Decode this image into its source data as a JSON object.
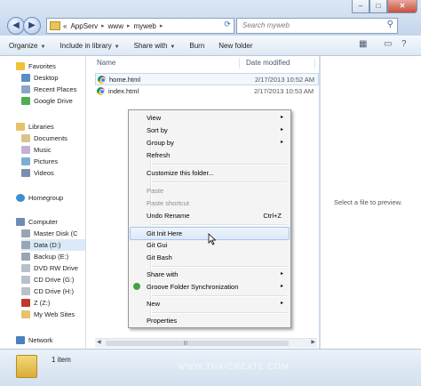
{
  "window": {
    "controls": {
      "minimize": "–",
      "maximize": "□",
      "close": "✕"
    }
  },
  "address_bar": {
    "breadcrumbs": [
      "AppServ",
      "www",
      "myweb"
    ],
    "overflow": "«",
    "separator": "▸"
  },
  "search": {
    "placeholder": "Search myweb",
    "icon": "search-icon"
  },
  "toolbar": {
    "items": [
      "Organize",
      "Include in library",
      "Share with",
      "Burn",
      "New folder"
    ]
  },
  "nav_pane": {
    "favorites": {
      "label": "Favorites",
      "items": [
        "Desktop",
        "Recent Places",
        "Google Drive"
      ]
    },
    "libraries": {
      "label": "Libraries",
      "items": [
        "Documents",
        "Music",
        "Pictures",
        "Videos"
      ]
    },
    "homegroup": "Homegroup",
    "computer": {
      "label": "Computer",
      "items": [
        "Master Disk (C",
        "Data (D:)",
        "Backup (E:)",
        "DVD RW Drive",
        "CD Drive (G:)",
        "CD Drive (H:)",
        "Z (Z:)",
        "My Web Sites"
      ]
    },
    "network": "Network"
  },
  "file_list": {
    "columns": {
      "name": "Name",
      "date_modified": "Date modified"
    },
    "files": [
      {
        "name": "home.html",
        "date": "2/17/2013 10:52 AM"
      },
      {
        "name": "index.html",
        "date": "2/17/2013 10:53 AM"
      }
    ]
  },
  "preview": {
    "text": "Select a file to preview."
  },
  "status": {
    "count": "1 item"
  },
  "watermark": "WWW.THAICREATE.COM",
  "context_menu": {
    "view": "View",
    "sort_by": "Sort by",
    "group_by": "Group by",
    "refresh": "Refresh",
    "customize": "Customize this folder...",
    "paste": "Paste",
    "paste_shortcut": "Paste shortcut",
    "undo_rename": "Undo Rename",
    "undo_shortcut": "Ctrl+Z",
    "git_init": "Git Init Here",
    "git_gui": "Git Gui",
    "git_bash": "Git Bash",
    "share_with": "Share with",
    "groove": "Groove Folder Synchronization",
    "new": "New",
    "properties": "Properties",
    "submenu_arrow": "▸"
  },
  "colors": {
    "accent": "#3e6fae",
    "highlight": "#dde9f8",
    "folder": "#e9c45a"
  }
}
